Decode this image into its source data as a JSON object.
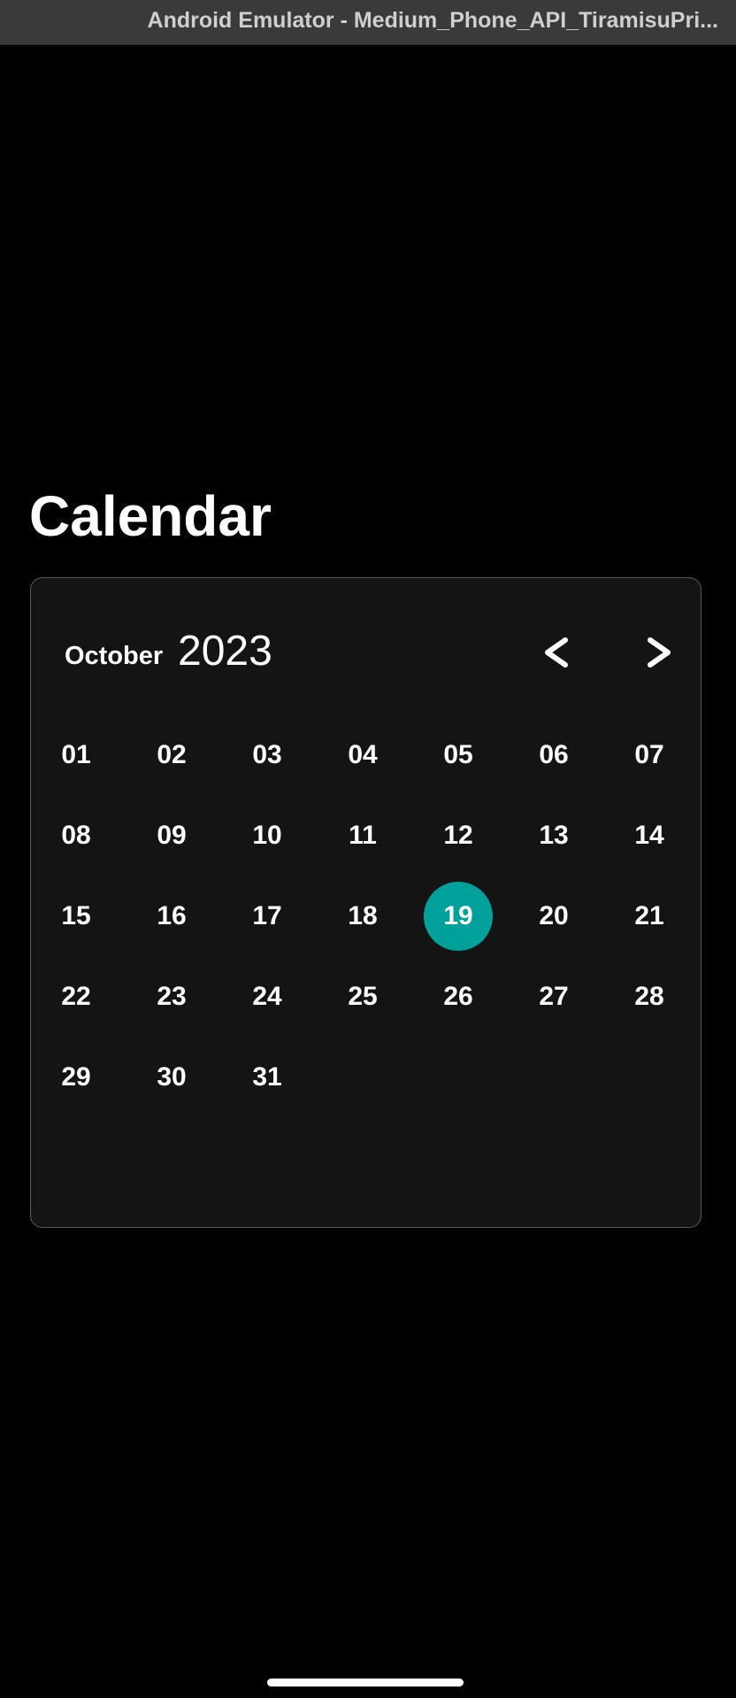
{
  "window": {
    "title": "Android Emulator - Medium_Phone_API_TiramisuPri..."
  },
  "page": {
    "title": "Calendar"
  },
  "calendar": {
    "month": "October",
    "year": "2023",
    "prev_icon": "chevron-left-icon",
    "next_icon": "chevron-right-icon",
    "selected_day": "19",
    "accent_color": "#00a19a",
    "days": [
      "01",
      "02",
      "03",
      "04",
      "05",
      "06",
      "07",
      "08",
      "09",
      "10",
      "11",
      "12",
      "13",
      "14",
      "15",
      "16",
      "17",
      "18",
      "19",
      "20",
      "21",
      "22",
      "23",
      "24",
      "25",
      "26",
      "27",
      "28",
      "29",
      "30",
      "31"
    ]
  }
}
